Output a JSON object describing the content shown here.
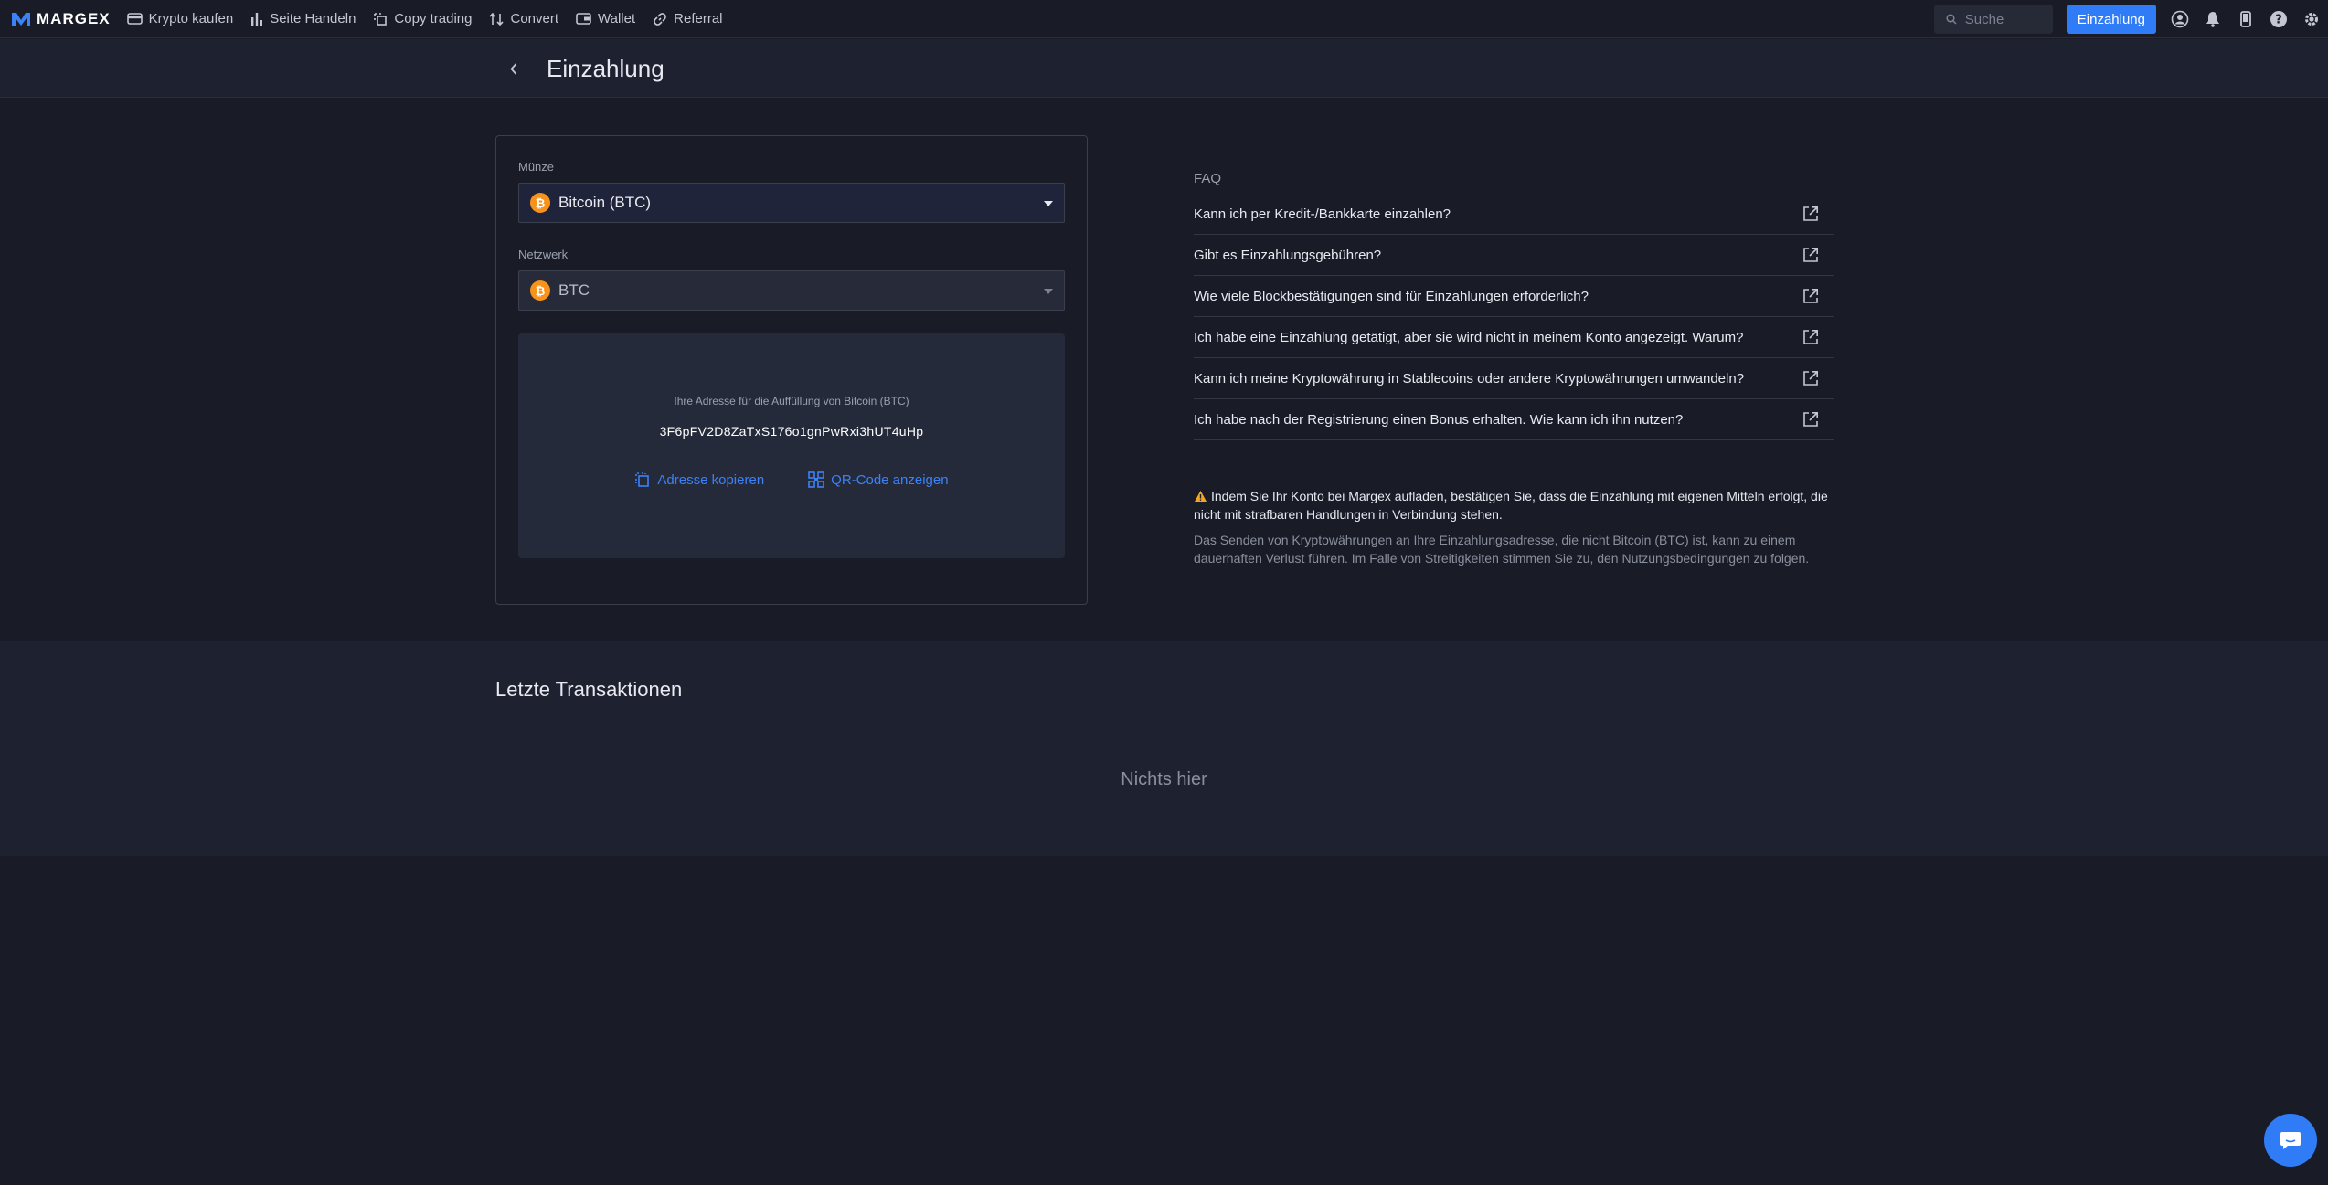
{
  "brand": {
    "name": "MARGEX"
  },
  "nav": {
    "items": [
      {
        "label": "Krypto kaufen",
        "icon": "card-icon"
      },
      {
        "label": "Seite Handeln",
        "icon": "bar-chart-icon"
      },
      {
        "label": "Copy trading",
        "icon": "copy-trading-icon"
      },
      {
        "label": "Convert",
        "icon": "convert-icon"
      },
      {
        "label": "Wallet",
        "icon": "wallet-icon"
      },
      {
        "label": "Referral",
        "icon": "link-icon"
      }
    ],
    "search_placeholder": "Suche",
    "deposit_button": "Einzahlung",
    "right_icons": [
      "account-icon",
      "bell-icon",
      "mobile-icon",
      "help-icon",
      "settings-icon"
    ]
  },
  "header": {
    "title": "Einzahlung"
  },
  "form": {
    "coin_label": "Münze",
    "coin_value": "Bitcoin (BTC)",
    "coin_symbol": "₿",
    "network_label": "Netzwerk",
    "network_value": "BTC",
    "address_label": "Ihre Adresse für die Auffüllung von Bitcoin (BTC)",
    "address_value": "3F6pFV2D8ZaTxS176o1gnPwRxi3hUT4uHp",
    "copy_label": "Adresse kopieren",
    "qr_label": "QR-Code anzeigen"
  },
  "faq": {
    "title": "FAQ",
    "items": [
      "Kann ich per Kredit-/Bankkarte einzahlen?",
      "Gibt es Einzahlungsgebühren?",
      "Wie viele Blockbestätigungen sind für Einzahlungen erforderlich?",
      "Ich habe eine Einzahlung getätigt, aber sie wird nicht in meinem Konto angezeigt. Warum?",
      "Kann ich meine Kryptowährung in Stablecoins oder andere Kryptowährungen umwandeln?",
      "Ich habe nach der Registrierung einen Bonus erhalten. Wie kann ich ihn nutzen?"
    ],
    "warning": "Indem Sie Ihr Konto bei Margex aufladen, bestätigen Sie, dass die Einzahlung mit eigenen Mitteln erfolgt, die nicht mit strafbaren Handlungen in Verbindung stehen.",
    "disclaimer": "Das Senden von Kryptowährungen an Ihre Einzahlungsadresse, die nicht Bitcoin (BTC) ist, kann zu einem dauerhaften Verlust führen. Im Falle von Streitigkeiten stimmen Sie zu, den Nutzungsbedingungen zu folgen."
  },
  "transactions": {
    "title": "Letzte Transaktionen",
    "empty": "Nichts hier"
  },
  "colors": {
    "accent": "#2f7cf6",
    "link": "#3b82f6",
    "bitcoin": "#f7931a",
    "background": "#191c27",
    "warning": "#f5a524"
  }
}
